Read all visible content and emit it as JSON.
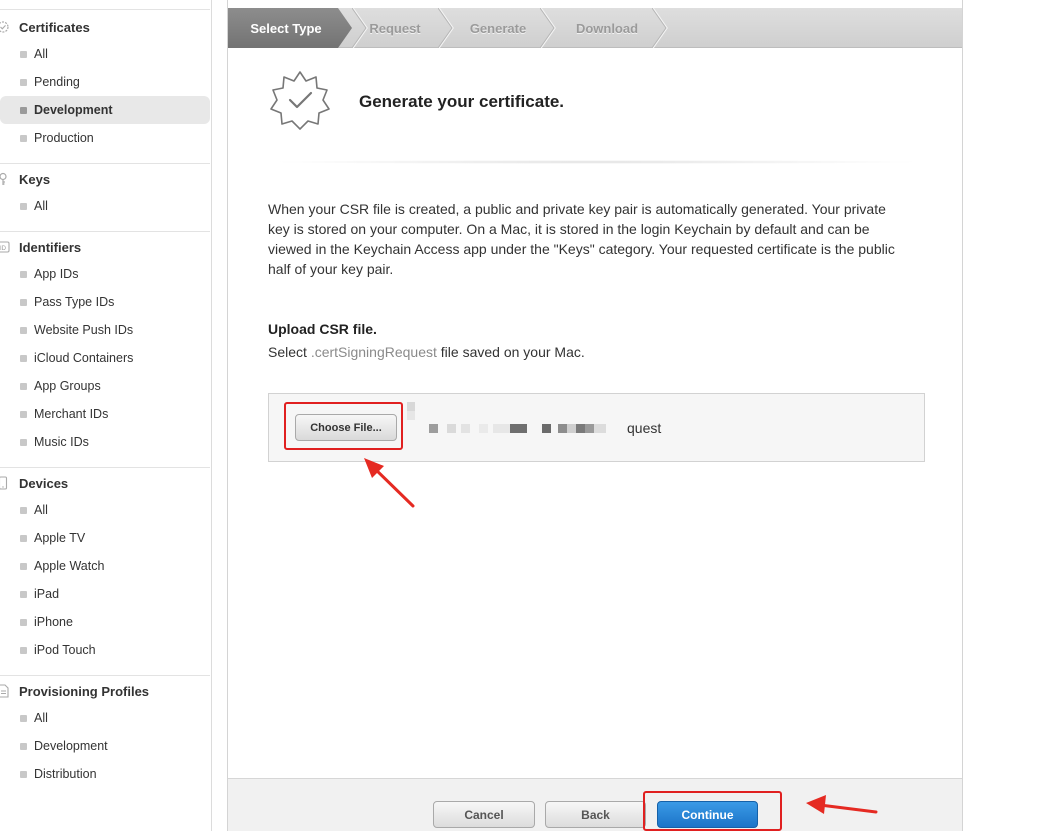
{
  "sidebar": {
    "sections": [
      {
        "title": "Certificates",
        "icon": "gear-badge-icon",
        "items": [
          "All",
          "Pending",
          "Development",
          "Production"
        ],
        "active": "Development"
      },
      {
        "title": "Keys",
        "icon": "key-icon",
        "items": [
          "All"
        ]
      },
      {
        "title": "Identifiers",
        "icon": "id-icon",
        "items": [
          "App IDs",
          "Pass Type IDs",
          "Website Push IDs",
          "iCloud Containers",
          "App Groups",
          "Merchant IDs",
          "Music IDs"
        ]
      },
      {
        "title": "Devices",
        "icon": "device-icon",
        "items": [
          "All",
          "Apple TV",
          "Apple Watch",
          "iPad",
          "iPhone",
          "iPod Touch"
        ]
      },
      {
        "title": "Provisioning Profiles",
        "icon": "document-icon",
        "items": [
          "All",
          "Development",
          "Distribution"
        ]
      }
    ]
  },
  "steps": [
    "Select Type",
    "Request",
    "Generate",
    "Download"
  ],
  "active_step": "Select Type",
  "main": {
    "title": "Generate your certificate.",
    "description": "When your CSR file is created, a public and private key pair is automatically generated. Your private key is stored on your computer. On a Mac, it is stored in the login Keychain by default and can be viewed in the Keychain Access app under the \"Keys\" category. Your requested certificate is the public half of your key pair.",
    "upload_title": "Upload CSR file.",
    "upload_sub_prefix": "Select ",
    "upload_sub_ext": ".certSigningRequest",
    "upload_sub_suffix": " file saved on your Mac.",
    "choose_label": "Choose File...",
    "file_name_visible": "quest"
  },
  "footer": {
    "cancel": "Cancel",
    "back": "Back",
    "continue": "Continue"
  },
  "colors": {
    "highlight": "#e02020",
    "primary": "#1c74c8"
  }
}
